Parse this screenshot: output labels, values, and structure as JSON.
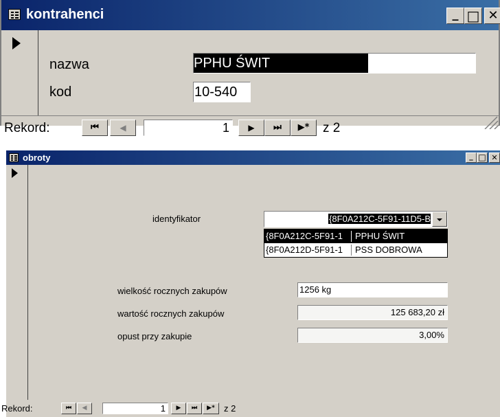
{
  "kontrahenci": {
    "title": "kontrahenci",
    "fields": {
      "nazwa_label": "nazwa",
      "nazwa_value": "PPHU ŚWIT",
      "kod_label": "kod",
      "kod_value": "10-540"
    },
    "nav": {
      "label": "Rekord:",
      "current": "1",
      "total": "z 2"
    }
  },
  "obroty": {
    "title": "obroty",
    "identyfikator_label": "identyfikator",
    "identyfikator_value": "{8F0A212C-5F91-11D5-B",
    "dropdown_options": [
      {
        "id": "{8F0A212C-5F91-1",
        "name": "PPHU ŚWIT"
      },
      {
        "id": "{8F0A212D-5F91-1",
        "name": "PSS DOBROWA"
      }
    ],
    "wielkosc_label": "wielkość rocznych zakupów",
    "wielkosc_value": "1256 kg",
    "wartosc_label": "wartość rocznych zakupów",
    "wartosc_value": "125 683,20 zł",
    "opust_label": "opust przy zakupie",
    "opust_value": "3,00%",
    "nav": {
      "label": "Rekord:",
      "current": "1",
      "total": "z 2"
    }
  },
  "title_buttons": {
    "minimize": "_",
    "maximize": "□",
    "close": "✕"
  },
  "nav_glyphs": {
    "first": "⏮",
    "prev": "◀",
    "next": "▶",
    "last": "⏭",
    "new": "▶*"
  },
  "colors": {
    "titlebar_start": "#0a246a",
    "titlebar_end": "#3a6ea5",
    "face": "#d4d0c8",
    "selection": "#000000"
  }
}
